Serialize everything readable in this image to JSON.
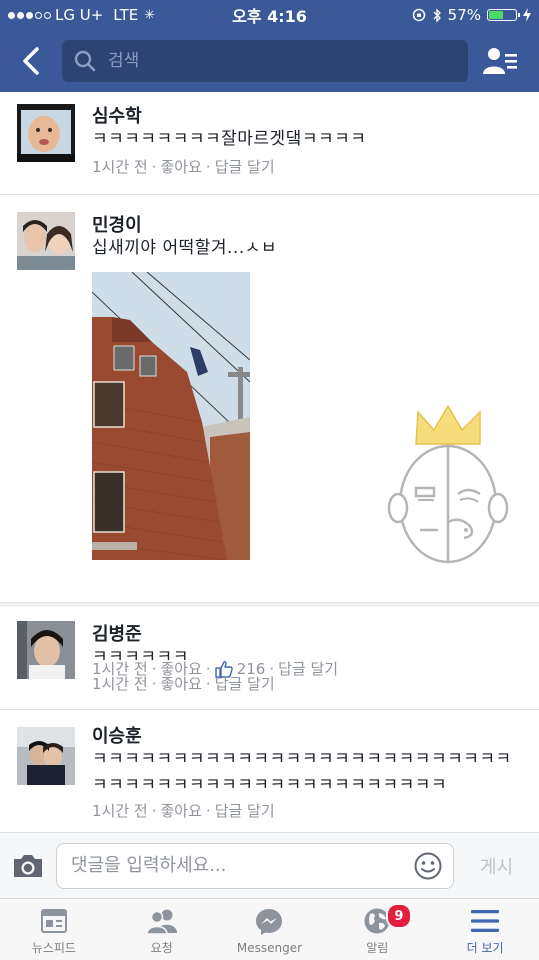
{
  "status_bar": {
    "carrier": "LG U+",
    "network": "LTE",
    "time": "오후 4:16",
    "battery": "57%",
    "battery_level": 0.57
  },
  "header": {
    "search_placeholder": "검색"
  },
  "comments": [
    {
      "name": "심수학",
      "text": "ㅋㅋㅋㅋㅋㅋㅋㅋ잘마르겟댘ㅋㅋㅋㅋ",
      "time": "1시간 전",
      "like": "좋아요",
      "reply": "답글 달기"
    },
    {
      "name": "민경이",
      "text": "십새끼야 어떡할겨...ㅅㅂ",
      "time": "1시간 전",
      "like": "좋아요",
      "like_count": "216",
      "reply": "답글 달기"
    },
    {
      "name": "김병준",
      "text": "ㅋㅋㅋㅋㅋㅋ",
      "time": "1시간 전",
      "like": "좋아요",
      "reply": "답글 달기"
    },
    {
      "name": "이승훈",
      "text": "ㅋㅋㅋㅋㅋㅋㅋㅋㅋㅋㅋㅋㅋㅋㅋㅋㅋㅋㅋㅋㅋㅋㅋㅋㅋㅋㅋㅋㅋㅋㅋㅋㅋㅋㅋㅋㅋㅋㅋㅋㅋㅋㅋㅋㅋㅋㅋㅋ",
      "time": "1시간 전",
      "like": "좋아요",
      "reply": "답글 달기"
    }
  ],
  "meta_separator": "·",
  "input_bar": {
    "placeholder": "댓글을 입력하세요...",
    "post_label": "게시"
  },
  "tabs": [
    {
      "label": "뉴스피드",
      "icon": "newsfeed-icon"
    },
    {
      "label": "요청",
      "icon": "friend-requests-icon"
    },
    {
      "label": "Messenger",
      "icon": "messenger-icon"
    },
    {
      "label": "알림",
      "icon": "globe-icon",
      "badge": "9"
    },
    {
      "label": "더 보기",
      "icon": "menu-icon",
      "active": true
    }
  ],
  "colors": {
    "brand": "#3b5998",
    "badge": "#e41e3f",
    "active_tab": "#4267b2",
    "meta_text": "#90949c"
  }
}
